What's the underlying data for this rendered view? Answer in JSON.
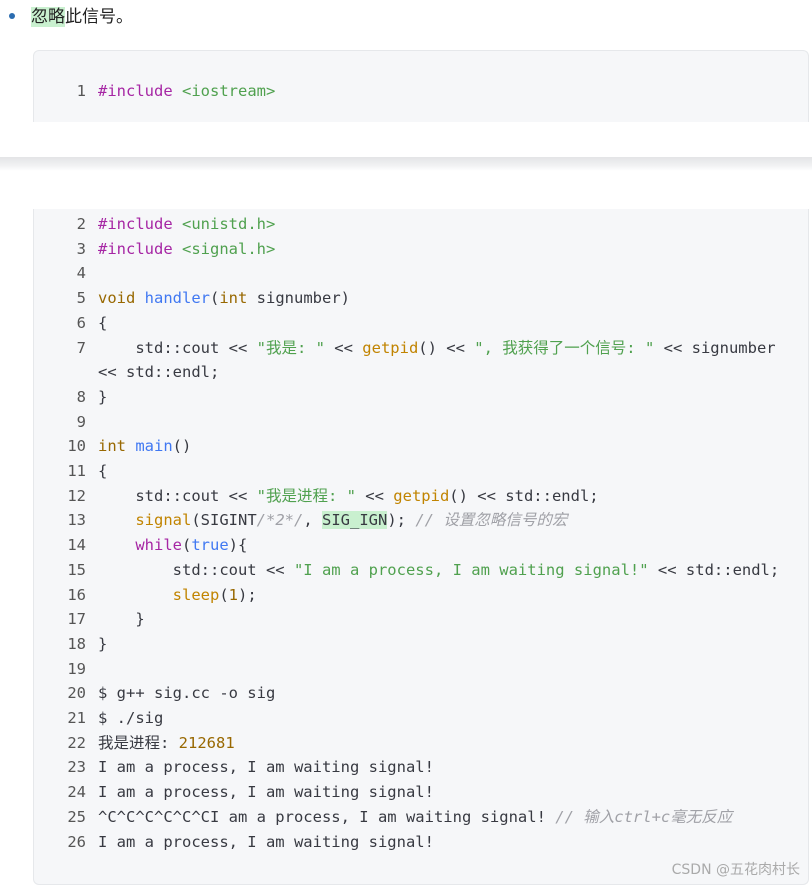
{
  "bullet": {
    "highlight": "忽略",
    "rest": "此信号。"
  },
  "code_block_1": {
    "lines": [
      {
        "num": "1",
        "parts": [
          [
            "k",
            "#include"
          ],
          [
            "p",
            " "
          ],
          [
            "s",
            "<iostream>"
          ]
        ]
      }
    ]
  },
  "code_block_2": {
    "lines": [
      {
        "num": "2",
        "parts": [
          [
            "k",
            "#include"
          ],
          [
            "p",
            " "
          ],
          [
            "s",
            "<unistd.h>"
          ]
        ]
      },
      {
        "num": "3",
        "parts": [
          [
            "k",
            "#include"
          ],
          [
            "p",
            " "
          ],
          [
            "s",
            "<signal.h>"
          ]
        ]
      },
      {
        "num": "4",
        "parts": []
      },
      {
        "num": "5",
        "parts": [
          [
            "t",
            "void"
          ],
          [
            "p",
            " "
          ],
          [
            "f",
            "handler"
          ],
          [
            "p",
            "("
          ],
          [
            "t",
            "int"
          ],
          [
            "p",
            " signumber)"
          ]
        ]
      },
      {
        "num": "6",
        "parts": [
          [
            "p",
            "{"
          ]
        ]
      },
      {
        "num": "7",
        "parts": [
          [
            "p",
            "    std::cout << "
          ],
          [
            "s",
            "\"我是: \""
          ],
          [
            "p",
            " << "
          ],
          [
            "call",
            "getpid"
          ],
          [
            "p",
            "() << "
          ],
          [
            "s",
            "\", 我获得了一个信号: \""
          ],
          [
            "p",
            " << signumber"
          ]
        ]
      },
      {
        "num": "",
        "parts": [
          [
            "p",
            "<< std::endl;"
          ]
        ]
      },
      {
        "num": "8",
        "parts": [
          [
            "p",
            "}"
          ]
        ]
      },
      {
        "num": "9",
        "parts": []
      },
      {
        "num": "10",
        "parts": [
          [
            "t",
            "int"
          ],
          [
            "p",
            " "
          ],
          [
            "f",
            "main"
          ],
          [
            "p",
            "()"
          ]
        ]
      },
      {
        "num": "11",
        "parts": [
          [
            "p",
            "{"
          ]
        ]
      },
      {
        "num": "12",
        "parts": [
          [
            "p",
            "    std::cout << "
          ],
          [
            "s",
            "\"我是进程: \""
          ],
          [
            "p",
            " << "
          ],
          [
            "call",
            "getpid"
          ],
          [
            "p",
            "() << std::endl;"
          ]
        ]
      },
      {
        "num": "13",
        "parts": [
          [
            "p",
            "    "
          ],
          [
            "call",
            "signal"
          ],
          [
            "p",
            "(SIGINT"
          ],
          [
            "c",
            "/*2*/"
          ],
          [
            "p",
            ", "
          ],
          [
            "hl",
            "SIG_IGN"
          ],
          [
            "p",
            "); "
          ],
          [
            "c",
            "// 设置忽略信号的宏"
          ]
        ]
      },
      {
        "num": "14",
        "parts": [
          [
            "p",
            "    "
          ],
          [
            "k",
            "while"
          ],
          [
            "p",
            "("
          ],
          [
            "f",
            "true"
          ],
          [
            "p",
            "){"
          ]
        ]
      },
      {
        "num": "15",
        "parts": [
          [
            "p",
            "        std::cout << "
          ],
          [
            "s",
            "\"I am a process, I am waiting signal!\""
          ],
          [
            "p",
            " << std::endl;"
          ]
        ]
      },
      {
        "num": "16",
        "parts": [
          [
            "p",
            "        "
          ],
          [
            "call",
            "sleep"
          ],
          [
            "p",
            "("
          ],
          [
            "n",
            "1"
          ],
          [
            "p",
            ");"
          ]
        ]
      },
      {
        "num": "17",
        "parts": [
          [
            "p",
            "    }"
          ]
        ]
      },
      {
        "num": "18",
        "parts": [
          [
            "p",
            "}"
          ]
        ]
      },
      {
        "num": "19",
        "parts": []
      },
      {
        "num": "20",
        "parts": [
          [
            "p",
            "$ g++ sig.cc -o sig"
          ]
        ]
      },
      {
        "num": "21",
        "parts": [
          [
            "p",
            "$ ./sig"
          ]
        ]
      },
      {
        "num": "22",
        "parts": [
          [
            "p",
            "我是进程: "
          ],
          [
            "n",
            "212681"
          ]
        ]
      },
      {
        "num": "23",
        "parts": [
          [
            "p",
            "I am a process, I am waiting signal!"
          ]
        ]
      },
      {
        "num": "24",
        "parts": [
          [
            "p",
            "I am a process, I am waiting signal!"
          ]
        ]
      },
      {
        "num": "25",
        "parts": [
          [
            "p",
            "^C^C^C^C^C^CI am a process, I am waiting signal! "
          ],
          [
            "c",
            "// 输入ctrl+c毫无反应"
          ]
        ]
      },
      {
        "num": "26",
        "parts": [
          [
            "p",
            "I am a process, I am waiting signal!"
          ]
        ]
      }
    ]
  },
  "watermark": "CSDN @五花肉村长"
}
